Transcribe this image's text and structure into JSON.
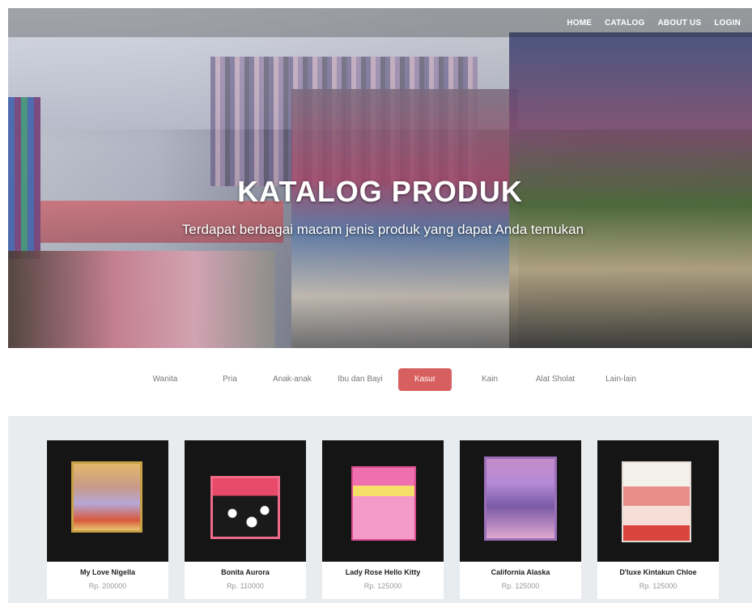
{
  "nav": {
    "links": [
      "HOME",
      "CATALOG",
      "ABOUT US",
      "LOGIN"
    ]
  },
  "hero": {
    "title": "KATALOG PRODUK",
    "subtitle": "Terdapat berbagai macam jenis produk yang dapat Anda temukan"
  },
  "categories": {
    "items": [
      "Wanita",
      "Pria",
      "Anak-anak",
      "Ibu dan Bayi",
      "Kasur",
      "Kain",
      "Alat Sholat",
      "Lain-lain"
    ],
    "active": "Kasur",
    "active_color": "#d75f5f"
  },
  "products": [
    {
      "name": "My Love Nigella",
      "price": "Rp. 200000"
    },
    {
      "name": "Bonita Aurora",
      "price": "Rp. 110000"
    },
    {
      "name": "Lady Rose Hello Kitty",
      "price": "Rp. 125000"
    },
    {
      "name": "California Alaska",
      "price": "Rp. 125000"
    },
    {
      "name": "D'luxe Kintakun Chloe",
      "price": "Rp. 125000"
    }
  ]
}
